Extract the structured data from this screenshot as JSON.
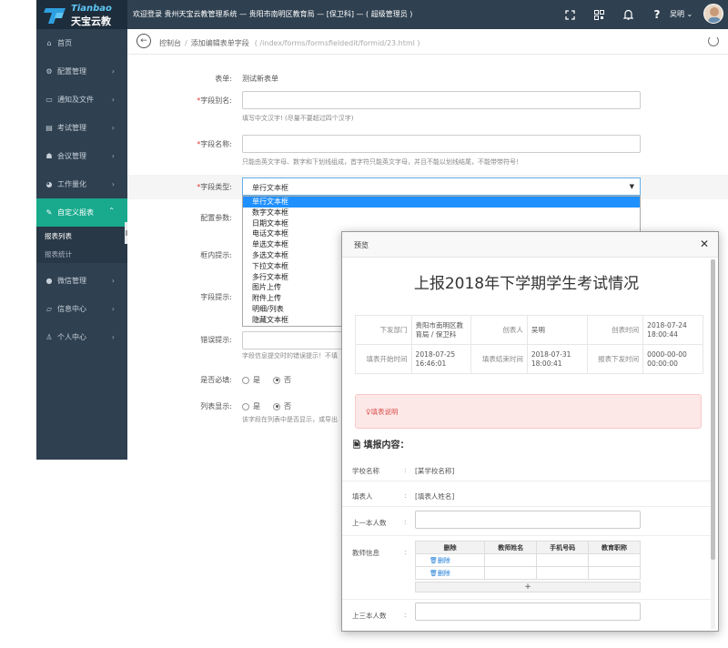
{
  "topbar": {
    "logo_en": "Tianbao",
    "logo_cn": "天宝云教",
    "welcome": "欢迎登录 贵州天宝云教管理系统 — 贵阳市南明区教育局 — [保卫科] — ( 超级管理员 )",
    "icons": [
      "fullscreen-icon",
      "qrcode-icon",
      "bell-icon",
      "help-icon"
    ],
    "user_name": "吴明"
  },
  "sidebar": {
    "items": [
      {
        "label": "首页",
        "icon": "home-icon"
      },
      {
        "label": "配置管理",
        "icon": "gear-icon"
      },
      {
        "label": "通知及文件",
        "icon": "folder-icon"
      },
      {
        "label": "考试管理",
        "icon": "book-icon"
      },
      {
        "label": "会议管理",
        "icon": "users-icon"
      },
      {
        "label": "工作量化",
        "icon": "pie-icon"
      },
      {
        "label": "自定义报表",
        "icon": "edit-icon"
      },
      {
        "label": "微信管理",
        "icon": "wechat-icon"
      },
      {
        "label": "信息中心",
        "icon": "folder-open-icon"
      },
      {
        "label": "个人中心",
        "icon": "user-icon"
      }
    ],
    "sub_items": [
      "报表列表",
      "报表统计"
    ]
  },
  "breadcrumb": {
    "home": "控制台",
    "current": "添加编辑表单字段",
    "path": "( /index/forms/formsfieldedit/formid/23.html )"
  },
  "form": {
    "form_label": "表单:",
    "form_value": "测试新表单",
    "alias_label": "字段别名:",
    "alias_help": "填写中文汉字! (尽量不要超过四个汉字)",
    "name_label": "字段名称:",
    "name_help": "只能由英文字母、数字和下划线组成，首字符只能英文字母，并且不能以划线结尾，不能带带符号！",
    "type_label": "字段类型:",
    "type_selected": "单行文本框",
    "type_options": [
      "单行文本框",
      "数字文本框",
      "日期文本框",
      "电话文本框",
      "单选文本框",
      "多选文本框",
      "下拉文本框",
      "多行文本框",
      "图片上传",
      "附件上传",
      "明细/列表",
      "隐藏文本框"
    ],
    "config_label": "配置参数:",
    "inner_tip_label": "框内提示:",
    "field_tip_label": "字段提示:",
    "error_tip_label": "错误提示:",
    "error_help": "字段信息提交时的错误提示！不填",
    "required_label": "是否必填:",
    "list_show_label": "列表显示:",
    "list_show_help": "该字段在列表中是否显示，或导出",
    "yes": "是",
    "no": "否"
  },
  "modal": {
    "title": "预览",
    "heading": "上报2018年下学期学生考试情况",
    "info": [
      [
        "下发部门",
        "贵阳市南明区教育局 / 保卫科",
        "创表人",
        "吴明",
        "创表时间",
        "2018-07-24 18:00:44"
      ],
      [
        "填表开始时间",
        "2018-07-25 16:46:01",
        "填表结束时间",
        "2018-07-31 18:00:41",
        "报表下发时间",
        "0000-00-00 00:00:00"
      ]
    ],
    "alert": "♀填表说明",
    "section": "填报内容：",
    "school_label": "学校名称",
    "school_value": "[某学校名称]",
    "filler_label": "填表人",
    "filler_value": "[填表人姓名]",
    "prev1_label": "上一本人数",
    "teacher_label": "教师信息",
    "teacher_cols": [
      "删除",
      "教师姓名",
      "手机号码",
      "教育职称"
    ],
    "delete_label": "删除",
    "add_symbol": "+",
    "prev3_label": "上三本人数",
    "colon": ":"
  }
}
